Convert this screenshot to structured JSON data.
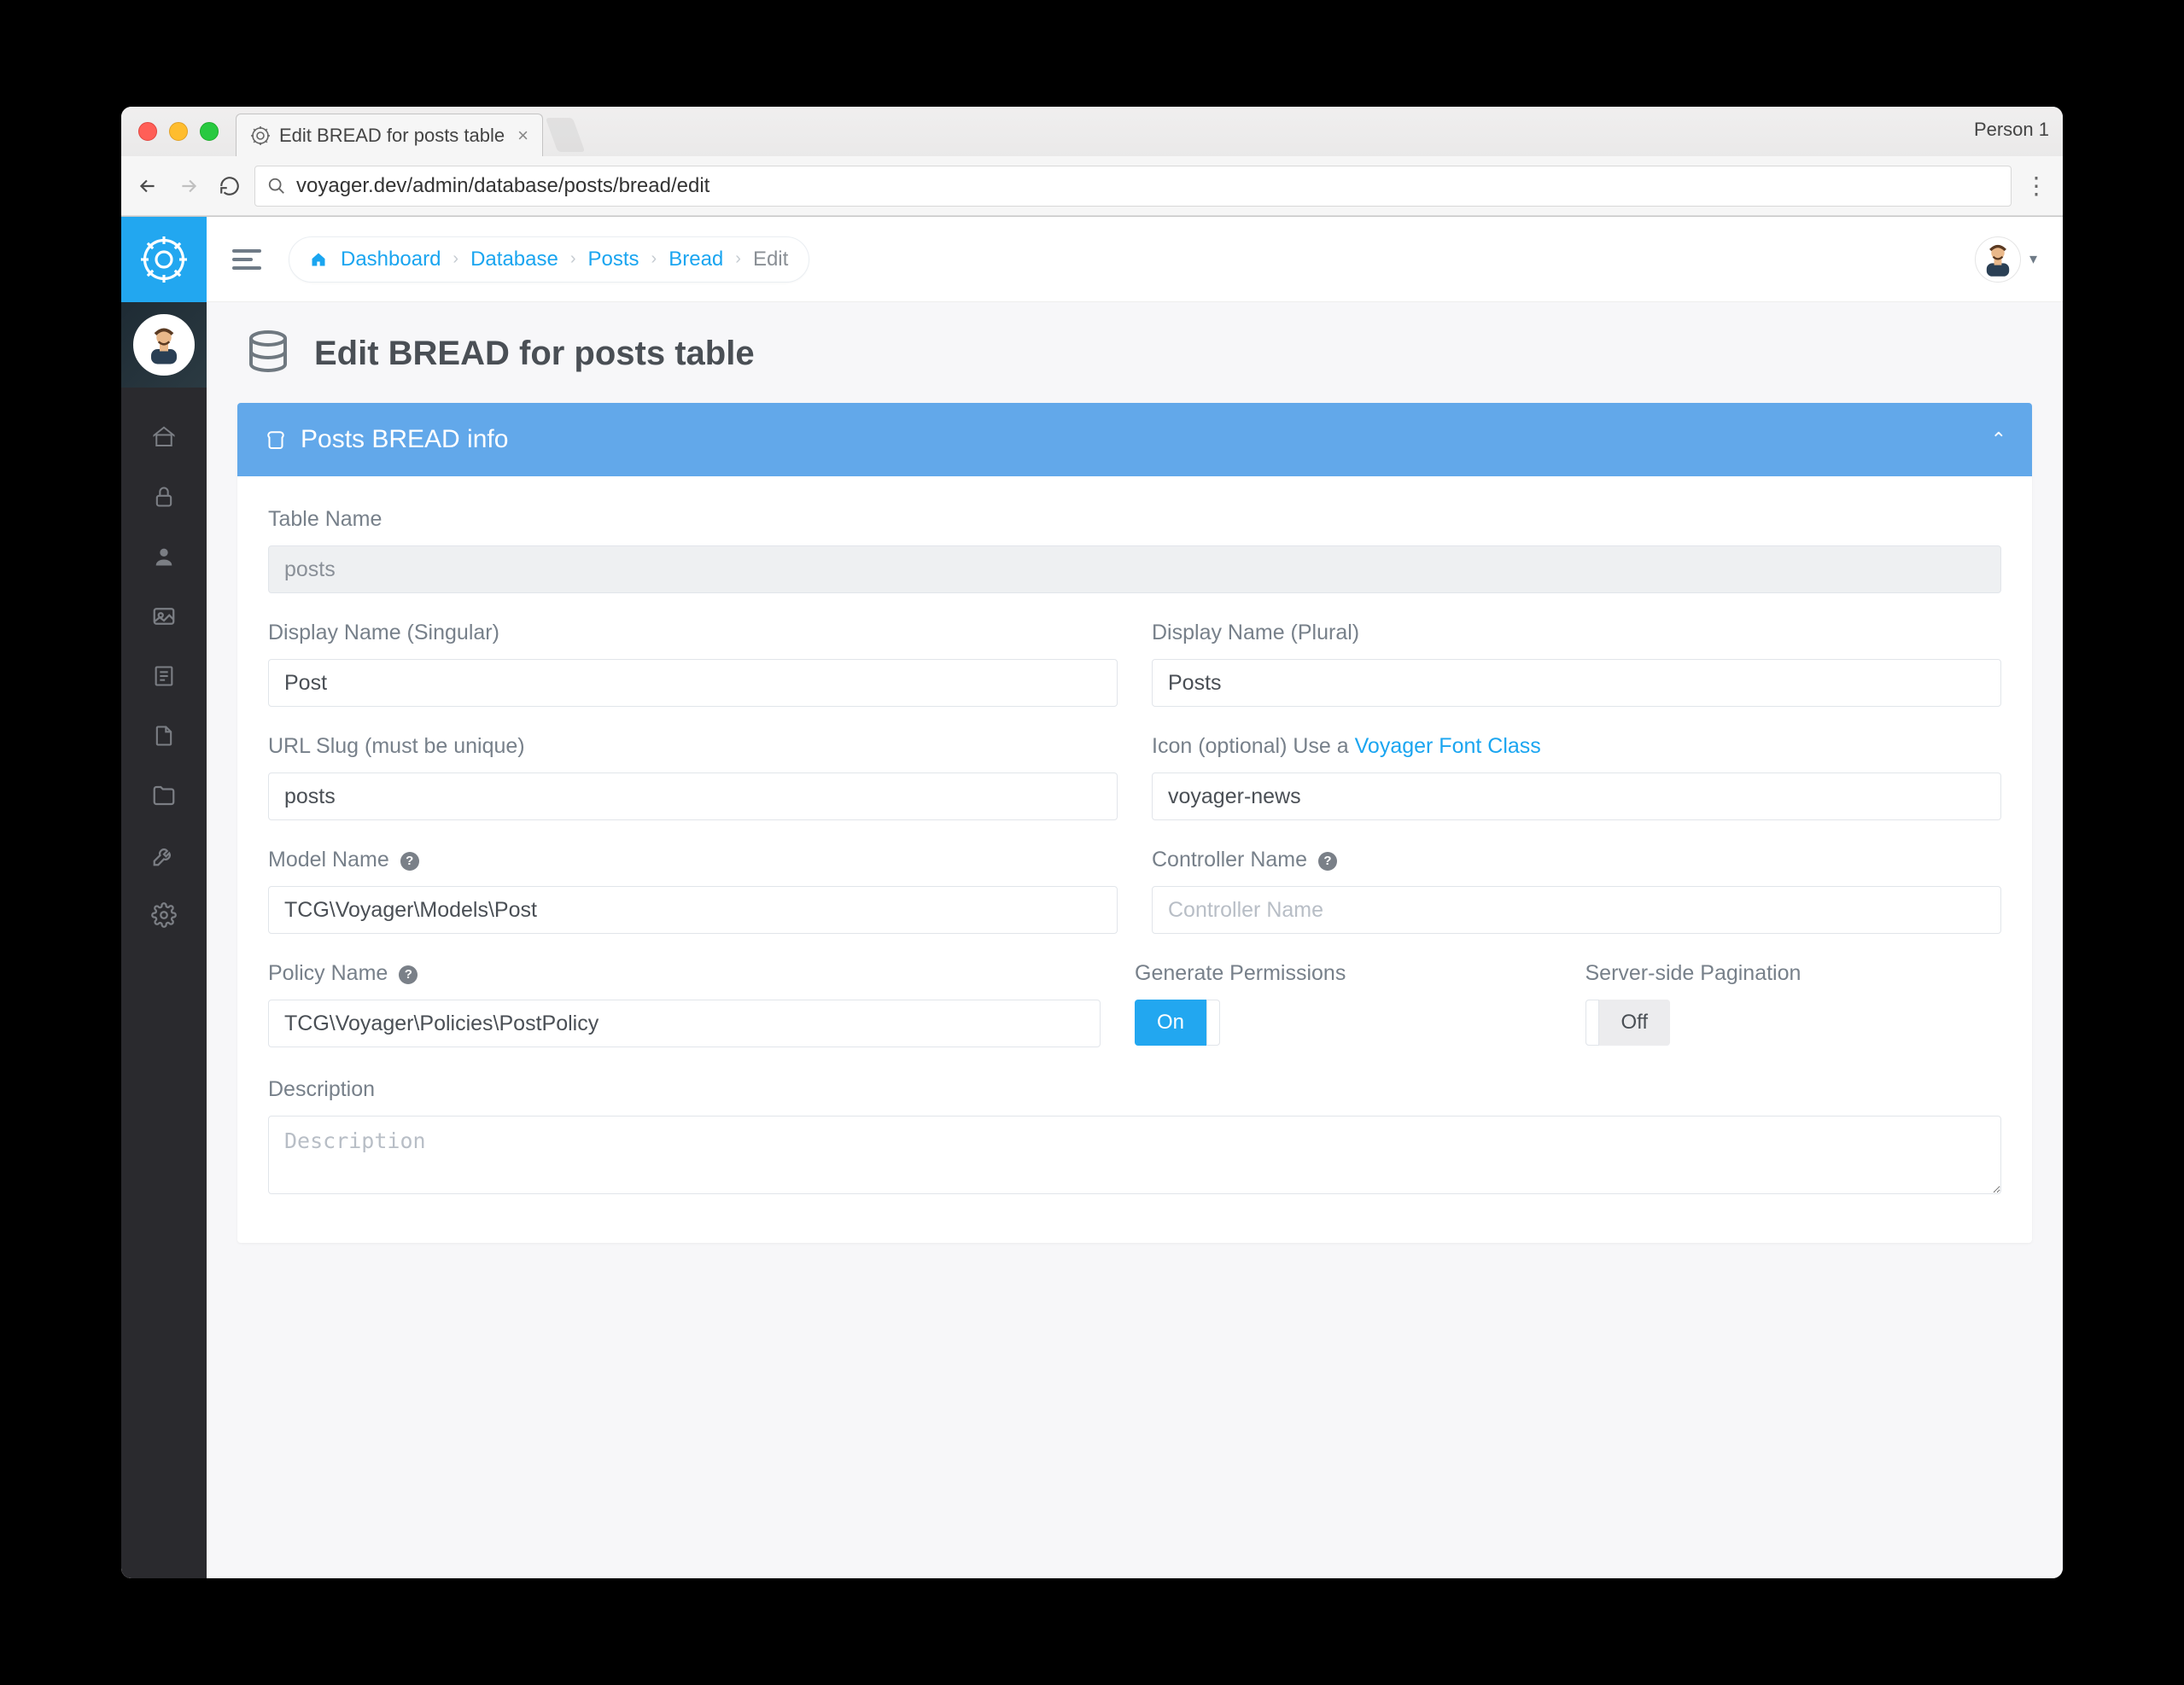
{
  "browser": {
    "tab_title": "Edit BREAD for posts table",
    "url": "voyager.dev/admin/database/posts/bread/edit",
    "person": "Person 1"
  },
  "breadcrumb": {
    "items": [
      {
        "label": "Dashboard"
      },
      {
        "label": "Database"
      },
      {
        "label": "Posts"
      },
      {
        "label": "Bread"
      }
    ],
    "current": "Edit"
  },
  "page": {
    "title": "Edit BREAD for posts table"
  },
  "panel": {
    "title": "Posts BREAD info"
  },
  "form": {
    "table_name": {
      "label": "Table Name",
      "value": "posts"
    },
    "display_name_singular": {
      "label": "Display Name (Singular)",
      "value": "Post"
    },
    "display_name_plural": {
      "label": "Display Name (Plural)",
      "value": "Posts"
    },
    "url_slug": {
      "label": "URL Slug (must be unique)",
      "value": "posts"
    },
    "icon": {
      "label_prefix": "Icon (optional) Use a ",
      "link_text": "Voyager Font Class",
      "value": "voyager-news"
    },
    "model_name": {
      "label": "Model Name",
      "value": "TCG\\Voyager\\Models\\Post"
    },
    "controller_name": {
      "label": "Controller Name",
      "placeholder": "Controller Name",
      "value": ""
    },
    "policy_name": {
      "label": "Policy Name",
      "value": "TCG\\Voyager\\Policies\\PostPolicy"
    },
    "generate_permissions": {
      "label": "Generate Permissions",
      "on_label": "On"
    },
    "server_side_pagination": {
      "label": "Server-side Pagination",
      "off_label": "Off"
    },
    "description": {
      "label": "Description",
      "placeholder": "Description",
      "value": ""
    }
  }
}
